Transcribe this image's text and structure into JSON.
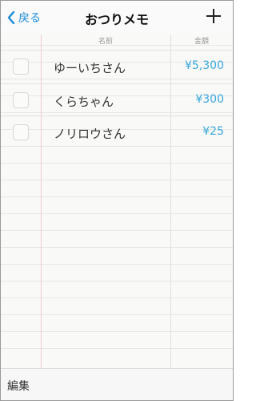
{
  "nav": {
    "back_label": "戻る",
    "title": "おつりメモ",
    "add_icon": "plus-icon",
    "back_icon": "chevron-left-icon"
  },
  "columns": {
    "name": "名前",
    "amount": "金額"
  },
  "rows": [
    {
      "name": "ゆーいちさん",
      "amount": "¥5,300",
      "checked": false
    },
    {
      "name": "くらちゃん",
      "amount": "¥300",
      "checked": false
    },
    {
      "name": "ノリロウさん",
      "amount": "¥25",
      "checked": false
    }
  ],
  "toolbar": {
    "edit_label": "編集"
  },
  "colors": {
    "accent": "#1a8ad8",
    "amount": "#39a7dd",
    "margin_line": "#f1c9d0"
  }
}
